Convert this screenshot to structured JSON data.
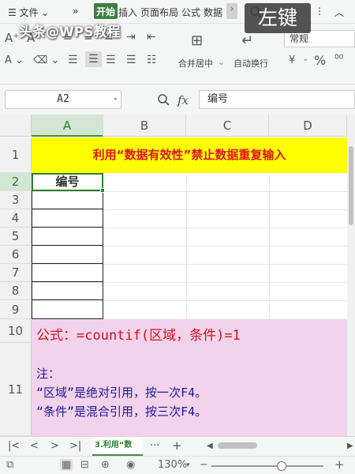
{
  "ribbon": {
    "menu_label": "☰ 文件 ⌄",
    "more_tabs": "»",
    "tabs": [
      "开始",
      "插入",
      "页面布局",
      "公式",
      "数据"
    ],
    "active_tab": "开始",
    "scroll_arrow": "›",
    "search_icon": "search-icon",
    "overflow": "⋮",
    "collapse": "︿",
    "merge_center": "合并居中",
    "wrap_text": "自动换行",
    "number_format": "常规",
    "percent": "%",
    "currency": "¥"
  },
  "overlay": {
    "watermark": "头条@WPS教程",
    "key_badge": "左键"
  },
  "formula_bar": {
    "cell_ref": "A2",
    "fx": "fx",
    "content": "编号"
  },
  "sheet": {
    "columns": [
      "A",
      "B",
      "C",
      "D"
    ],
    "active_column": "A",
    "rows": [
      "1",
      "2",
      "3",
      "4",
      "5",
      "6",
      "7",
      "8",
      "9",
      "10",
      "11"
    ],
    "active_row": "2",
    "title": "利用“数据有效性”禁止数据重复输入",
    "a2_value": "编号",
    "note_formula": "公式：=countif(区域，条件)=1",
    "note_label": "注：",
    "note_line1": "“区域”是绝对引用，按一次F4。",
    "note_line2": "“条件”是混合引用，按三次F4。"
  },
  "sheet_tabs": {
    "first": "|<",
    "prev": "<",
    "next": ">",
    "last": ">|",
    "active": "3.利用“数",
    "more": "···",
    "add": "+"
  },
  "status": {
    "zoom": "130%",
    "zoom_level": 0.63
  },
  "colors": {
    "title_bg": "#ffff00",
    "title_text": "#e0141a",
    "note_bg": "#f3d2eb",
    "formula_text": "#d0101a",
    "note_text": "#1a1a9c",
    "accent": "#2e7d32"
  }
}
